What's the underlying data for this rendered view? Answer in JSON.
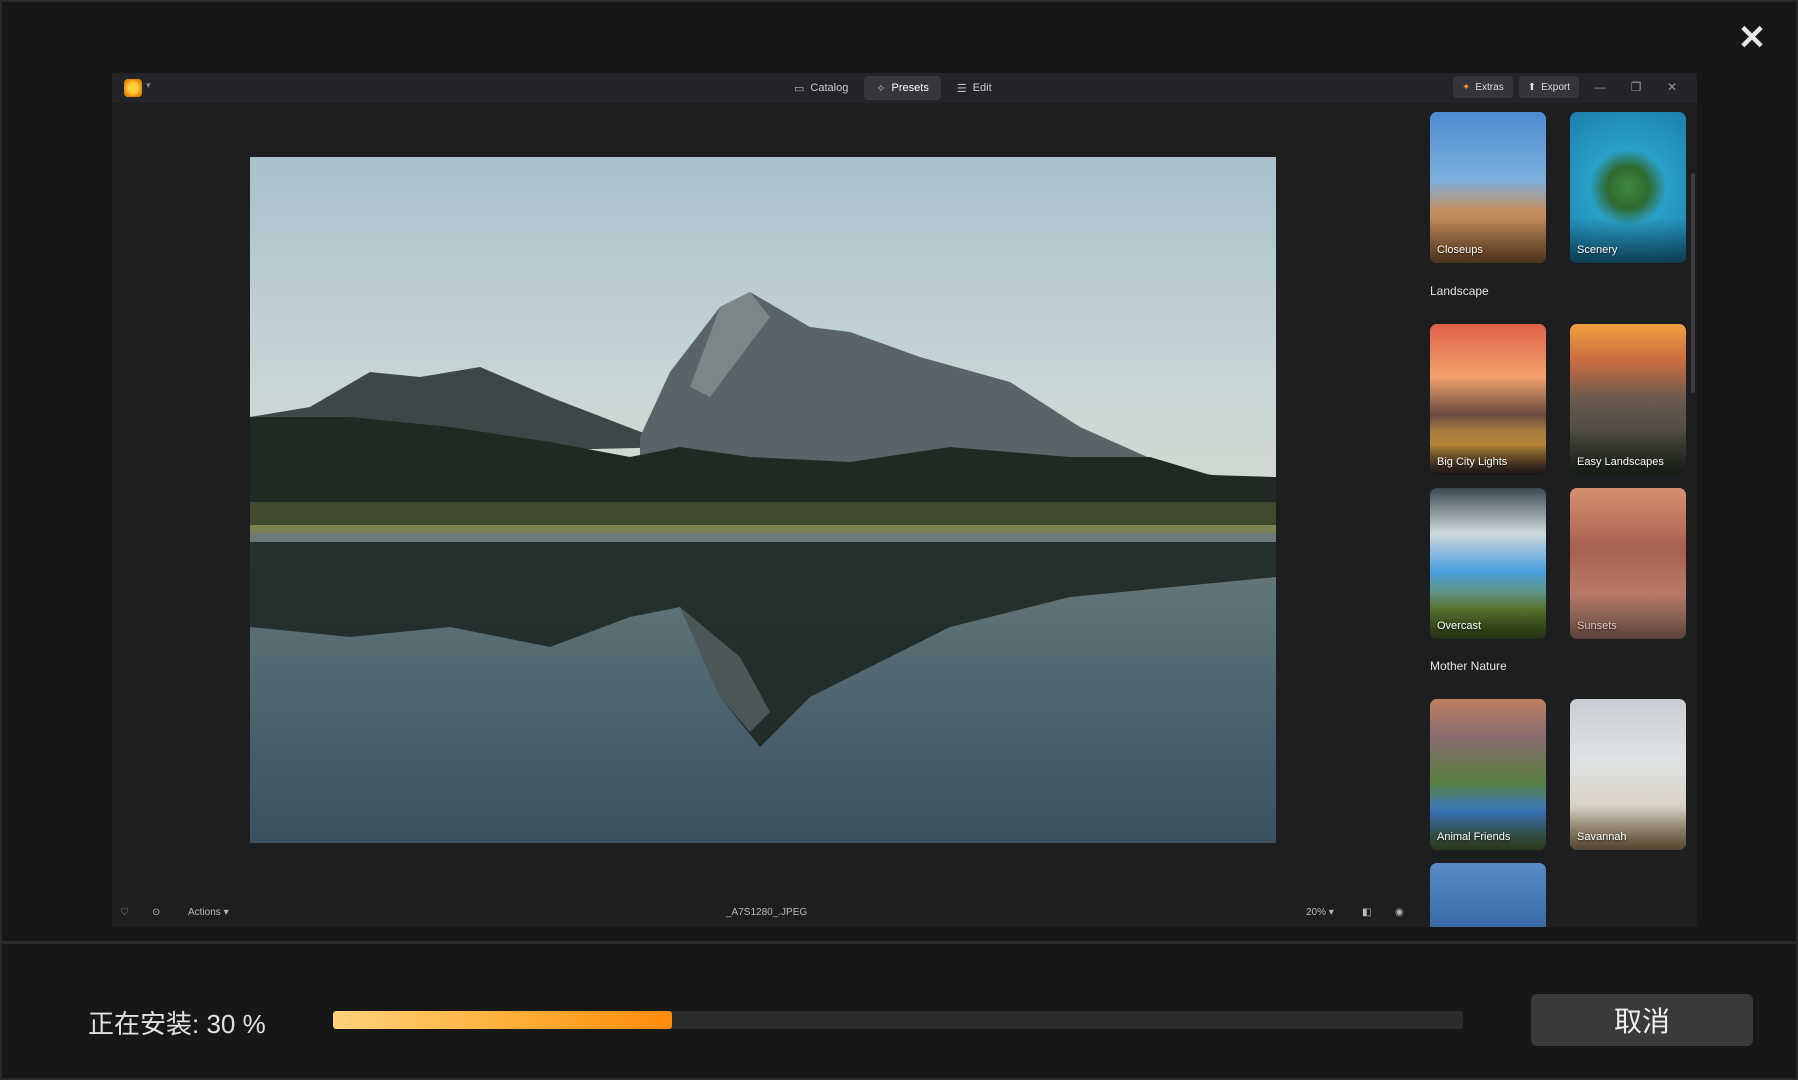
{
  "installer": {
    "close_label": "✕",
    "status_text": "正在安装: 30 %",
    "progress": 0.3,
    "cancel_label": "取消"
  },
  "app": {
    "tabs": [
      {
        "label": "Catalog",
        "icon": "folder-icon"
      },
      {
        "label": "Presets",
        "icon": "magic-wand-icon"
      },
      {
        "label": "Edit",
        "icon": "sliders-icon"
      }
    ],
    "extras_label": "Extras",
    "export_label": "Export",
    "presets": {
      "top": [
        {
          "label": "Closeups"
        },
        {
          "label": "Scenery"
        }
      ],
      "sections": [
        {
          "title": "Landscape",
          "items": [
            {
              "label": "Big City Lights"
            },
            {
              "label": "Easy Landscapes"
            },
            {
              "label": "Overcast"
            },
            {
              "label": "Sunsets"
            }
          ]
        },
        {
          "title": "Mother Nature",
          "items": [
            {
              "label": "Animal Friends"
            },
            {
              "label": "Savannah"
            }
          ]
        }
      ]
    },
    "bottom": {
      "actions_label": "Actions ▾",
      "filename": "_A7S1280_.JPEG",
      "zoom": "20% ▾"
    }
  },
  "colors": {
    "accent": "#ff8b0a",
    "accent_light": "#ffd27a"
  }
}
